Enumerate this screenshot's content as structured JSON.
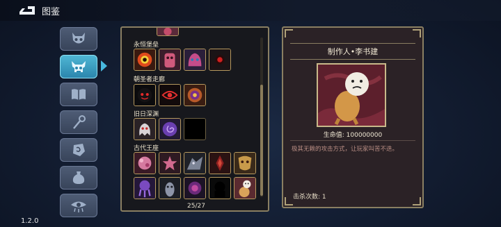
{
  "header": {
    "title": "图鉴",
    "back_icon": "back-arrow-icon"
  },
  "version": "1.2.0",
  "sidebar": {
    "items": [
      {
        "name": "demon-mask-icon",
        "active": false
      },
      {
        "name": "boss-skull-icon",
        "active": true
      },
      {
        "name": "book-icon",
        "active": false
      },
      {
        "name": "staff-icon",
        "active": false
      },
      {
        "name": "rune-stone-icon",
        "active": false
      },
      {
        "name": "pouch-icon",
        "active": false
      },
      {
        "name": "eye-icon",
        "active": false
      }
    ]
  },
  "list": {
    "categories": [
      {
        "label": "永恒堡垒",
        "cells": [
          "red-eye-monster",
          "pink-golem",
          "purple-beast",
          "dark-orb-eye"
        ]
      },
      {
        "label": "朝圣者走廊",
        "cells": [
          "shadow-face",
          "red-eye-glyph",
          "purple-eye-orb"
        ]
      },
      {
        "label": "旧日深渊",
        "cells": [
          "white-wraith",
          "purple-spiral",
          "locked-dark"
        ]
      },
      {
        "label": "古代王座",
        "cells": [
          "pink-flower-beast",
          "pink-petal",
          "grey-dragon",
          "red-horned",
          "gold-mask",
          "purple-tentacle",
          "grey-mummy",
          "purple-orb",
          "shadow-silhouette",
          "meme-cat"
        ]
      }
    ],
    "page_count": "25/27"
  },
  "detail": {
    "name": "制作人•李书建",
    "hp_label": "生命值: 100000000",
    "description": "极其无赖的攻击方式，让玩家叫苦不迭。",
    "kills_label": "击杀次数: 1"
  },
  "colors": {
    "accent": "#48b9df",
    "frame": "#8a7f62",
    "desc_text": "#b98e84"
  }
}
